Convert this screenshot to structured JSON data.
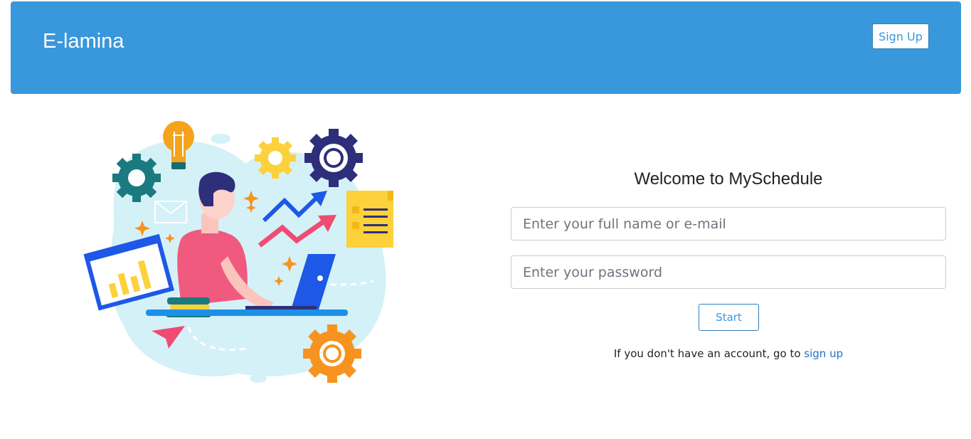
{
  "header": {
    "brand": "E-lamina",
    "signup_label": "Sign Up",
    "background_color": "#3898db"
  },
  "illustration": {
    "icon": "person-working-on-laptop-illustration"
  },
  "login": {
    "title": "Welcome to MySchedule",
    "name_placeholder": "Enter your full name or e-mail",
    "password_placeholder": "Enter your password",
    "start_label": "Start",
    "hint_text": "If you don't have an account, go to ",
    "hint_link": "sign up"
  },
  "colors": {
    "accent": "#3898db",
    "link": "#1a73c8"
  }
}
